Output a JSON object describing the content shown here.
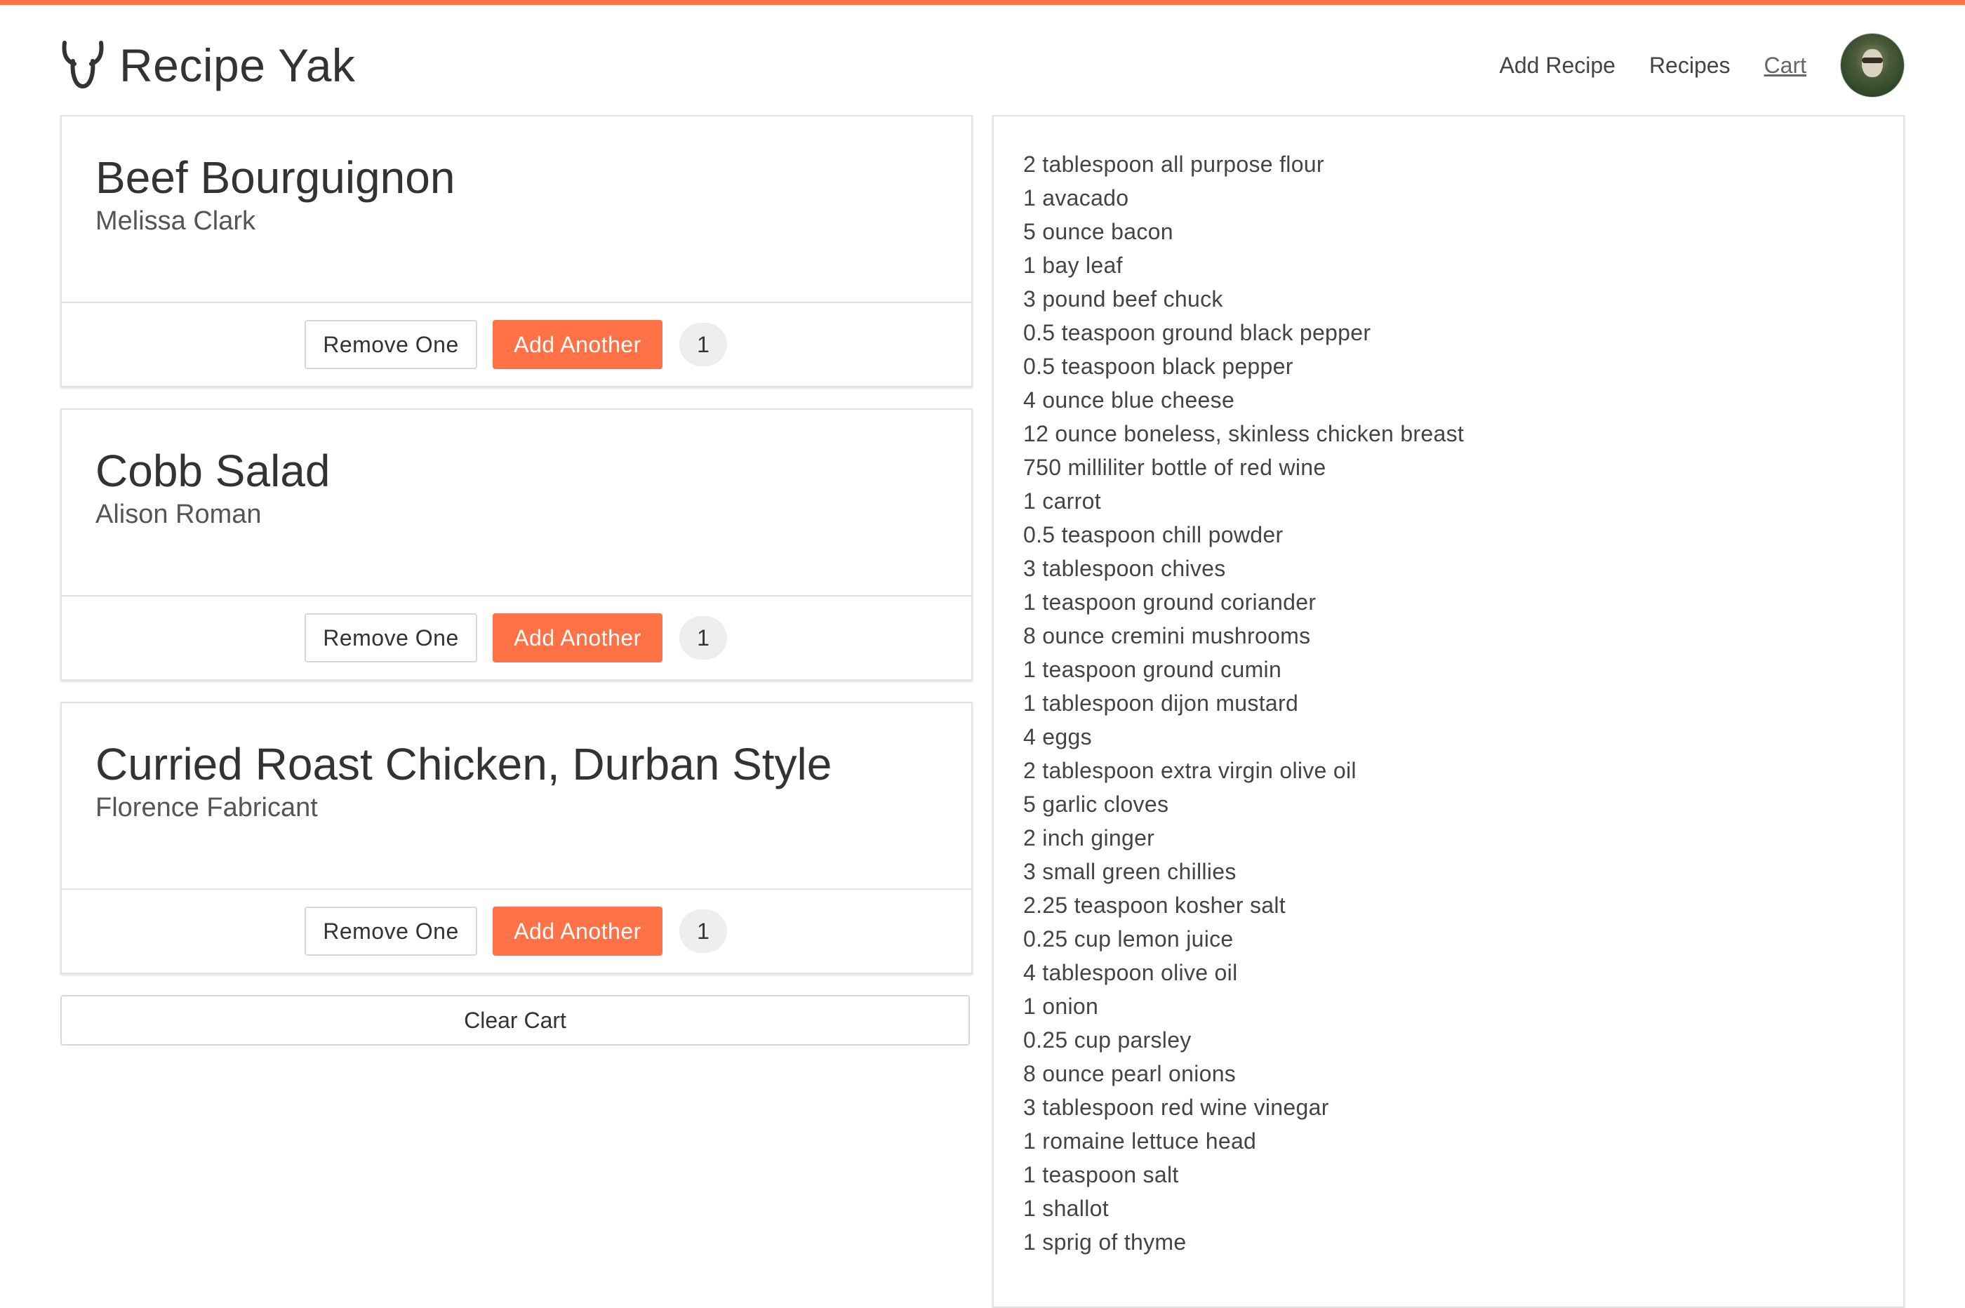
{
  "brand": {
    "name": "Recipe Yak"
  },
  "nav": {
    "add_recipe": "Add Recipe",
    "recipes": "Recipes",
    "cart": "Cart"
  },
  "colors": {
    "accent": "#ff7247",
    "border": "#e3e3e3",
    "badge_bg": "#eeeeee"
  },
  "cart_items": [
    {
      "title": "Beef Bourguignon",
      "author": "Melissa Clark",
      "remove_label": "Remove One",
      "add_label": "Add Another",
      "count": "1"
    },
    {
      "title": "Cobb Salad",
      "author": "Alison Roman",
      "remove_label": "Remove One",
      "add_label": "Add Another",
      "count": "1"
    },
    {
      "title": "Curried Roast Chicken, Durban Style",
      "author": "Florence Fabricant",
      "remove_label": "Remove One",
      "add_label": "Add Another",
      "count": "1"
    }
  ],
  "clear_cart_label": "Clear Cart",
  "ingredients": [
    "2 tablespoon all purpose flour",
    "1 avacado",
    "5 ounce bacon",
    "1 bay leaf",
    "3 pound beef chuck",
    "0.5 teaspoon ground black pepper",
    "0.5 teaspoon black pepper",
    "4 ounce blue cheese",
    "12 ounce boneless, skinless chicken breast",
    "750 milliliter bottle of red wine",
    "1 carrot",
    "0.5 teaspoon chill powder",
    "3 tablespoon chives",
    "1 teaspoon ground coriander",
    "8 ounce cremini mushrooms",
    "1 teaspoon ground cumin",
    "1 tablespoon dijon mustard",
    "4 eggs",
    "2 tablespoon extra virgin olive oil",
    "5 garlic cloves",
    "2 inch ginger",
    "3 small green chillies",
    "2.25 teaspoon kosher salt",
    "0.25 cup lemon juice",
    "4 tablespoon olive oil",
    "1 onion",
    "0.25 cup parsley",
    "8 ounce pearl onions",
    "3 tablespoon red wine vinegar",
    "1 romaine lettuce head",
    "1 teaspoon salt",
    "1 shallot",
    "1 sprig of thyme"
  ]
}
